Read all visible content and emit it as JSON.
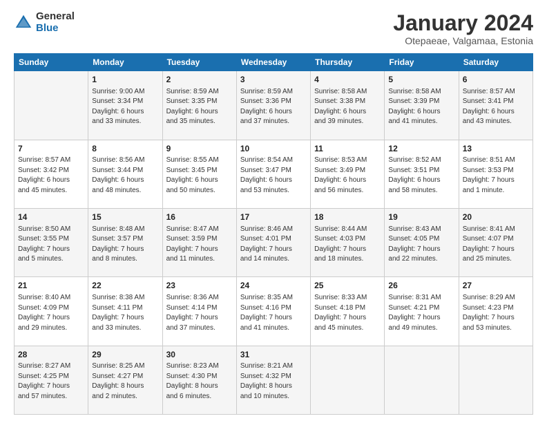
{
  "logo": {
    "general": "General",
    "blue": "Blue"
  },
  "header": {
    "title": "January 2024",
    "subtitle": "Otepaeae, Valgamaa, Estonia"
  },
  "weekdays": [
    "Sunday",
    "Monday",
    "Tuesday",
    "Wednesday",
    "Thursday",
    "Friday",
    "Saturday"
  ],
  "weeks": [
    [
      {
        "day": "",
        "info": ""
      },
      {
        "day": "1",
        "info": "Sunrise: 9:00 AM\nSunset: 3:34 PM\nDaylight: 6 hours\nand 33 minutes."
      },
      {
        "day": "2",
        "info": "Sunrise: 8:59 AM\nSunset: 3:35 PM\nDaylight: 6 hours\nand 35 minutes."
      },
      {
        "day": "3",
        "info": "Sunrise: 8:59 AM\nSunset: 3:36 PM\nDaylight: 6 hours\nand 37 minutes."
      },
      {
        "day": "4",
        "info": "Sunrise: 8:58 AM\nSunset: 3:38 PM\nDaylight: 6 hours\nand 39 minutes."
      },
      {
        "day": "5",
        "info": "Sunrise: 8:58 AM\nSunset: 3:39 PM\nDaylight: 6 hours\nand 41 minutes."
      },
      {
        "day": "6",
        "info": "Sunrise: 8:57 AM\nSunset: 3:41 PM\nDaylight: 6 hours\nand 43 minutes."
      }
    ],
    [
      {
        "day": "7",
        "info": "Sunrise: 8:57 AM\nSunset: 3:42 PM\nDaylight: 6 hours\nand 45 minutes."
      },
      {
        "day": "8",
        "info": "Sunrise: 8:56 AM\nSunset: 3:44 PM\nDaylight: 6 hours\nand 48 minutes."
      },
      {
        "day": "9",
        "info": "Sunrise: 8:55 AM\nSunset: 3:45 PM\nDaylight: 6 hours\nand 50 minutes."
      },
      {
        "day": "10",
        "info": "Sunrise: 8:54 AM\nSunset: 3:47 PM\nDaylight: 6 hours\nand 53 minutes."
      },
      {
        "day": "11",
        "info": "Sunrise: 8:53 AM\nSunset: 3:49 PM\nDaylight: 6 hours\nand 56 minutes."
      },
      {
        "day": "12",
        "info": "Sunrise: 8:52 AM\nSunset: 3:51 PM\nDaylight: 6 hours\nand 58 minutes."
      },
      {
        "day": "13",
        "info": "Sunrise: 8:51 AM\nSunset: 3:53 PM\nDaylight: 7 hours\nand 1 minute."
      }
    ],
    [
      {
        "day": "14",
        "info": "Sunrise: 8:50 AM\nSunset: 3:55 PM\nDaylight: 7 hours\nand 5 minutes."
      },
      {
        "day": "15",
        "info": "Sunrise: 8:48 AM\nSunset: 3:57 PM\nDaylight: 7 hours\nand 8 minutes."
      },
      {
        "day": "16",
        "info": "Sunrise: 8:47 AM\nSunset: 3:59 PM\nDaylight: 7 hours\nand 11 minutes."
      },
      {
        "day": "17",
        "info": "Sunrise: 8:46 AM\nSunset: 4:01 PM\nDaylight: 7 hours\nand 14 minutes."
      },
      {
        "day": "18",
        "info": "Sunrise: 8:44 AM\nSunset: 4:03 PM\nDaylight: 7 hours\nand 18 minutes."
      },
      {
        "day": "19",
        "info": "Sunrise: 8:43 AM\nSunset: 4:05 PM\nDaylight: 7 hours\nand 22 minutes."
      },
      {
        "day": "20",
        "info": "Sunrise: 8:41 AM\nSunset: 4:07 PM\nDaylight: 7 hours\nand 25 minutes."
      }
    ],
    [
      {
        "day": "21",
        "info": "Sunrise: 8:40 AM\nSunset: 4:09 PM\nDaylight: 7 hours\nand 29 minutes."
      },
      {
        "day": "22",
        "info": "Sunrise: 8:38 AM\nSunset: 4:11 PM\nDaylight: 7 hours\nand 33 minutes."
      },
      {
        "day": "23",
        "info": "Sunrise: 8:36 AM\nSunset: 4:14 PM\nDaylight: 7 hours\nand 37 minutes."
      },
      {
        "day": "24",
        "info": "Sunrise: 8:35 AM\nSunset: 4:16 PM\nDaylight: 7 hours\nand 41 minutes."
      },
      {
        "day": "25",
        "info": "Sunrise: 8:33 AM\nSunset: 4:18 PM\nDaylight: 7 hours\nand 45 minutes."
      },
      {
        "day": "26",
        "info": "Sunrise: 8:31 AM\nSunset: 4:21 PM\nDaylight: 7 hours\nand 49 minutes."
      },
      {
        "day": "27",
        "info": "Sunrise: 8:29 AM\nSunset: 4:23 PM\nDaylight: 7 hours\nand 53 minutes."
      }
    ],
    [
      {
        "day": "28",
        "info": "Sunrise: 8:27 AM\nSunset: 4:25 PM\nDaylight: 7 hours\nand 57 minutes."
      },
      {
        "day": "29",
        "info": "Sunrise: 8:25 AM\nSunset: 4:27 PM\nDaylight: 8 hours\nand 2 minutes."
      },
      {
        "day": "30",
        "info": "Sunrise: 8:23 AM\nSunset: 4:30 PM\nDaylight: 8 hours\nand 6 minutes."
      },
      {
        "day": "31",
        "info": "Sunrise: 8:21 AM\nSunset: 4:32 PM\nDaylight: 8 hours\nand 10 minutes."
      },
      {
        "day": "",
        "info": ""
      },
      {
        "day": "",
        "info": ""
      },
      {
        "day": "",
        "info": ""
      }
    ]
  ]
}
